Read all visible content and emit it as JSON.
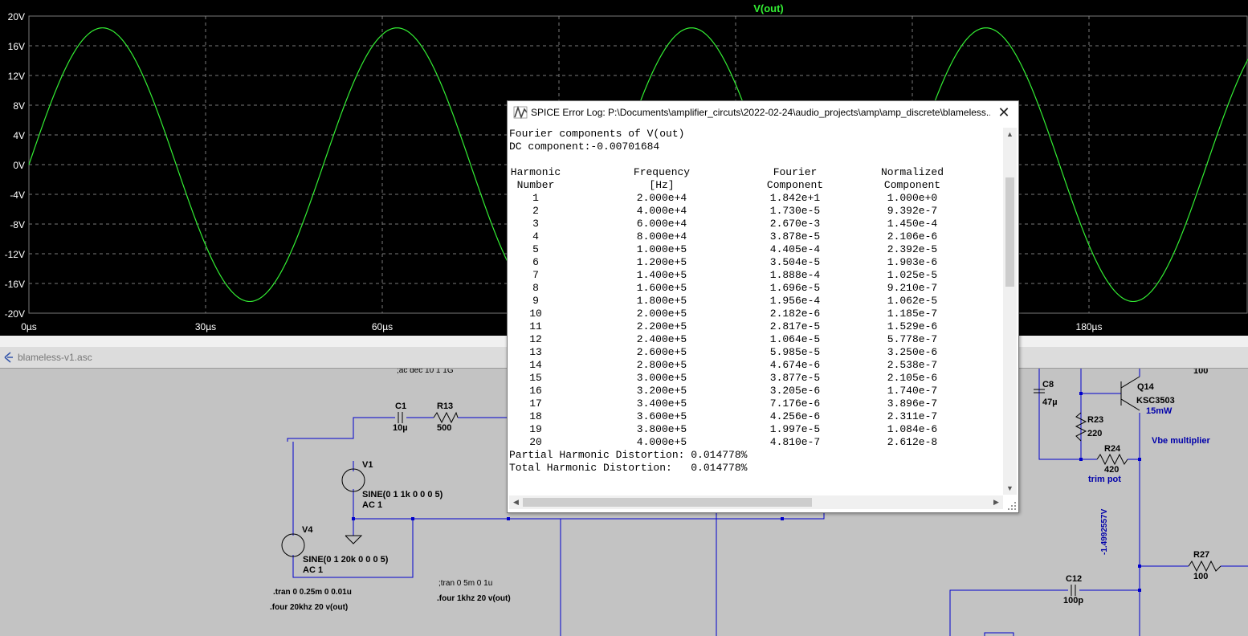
{
  "plot": {
    "trace_name": "V(out)",
    "y_ticks": [
      "20V",
      "16V",
      "12V",
      "8V",
      "4V",
      "0V",
      "-4V",
      "-8V",
      "-12V",
      "-16V",
      "-20V"
    ],
    "x_ticks": [
      "0µs",
      "30µs",
      "60µs",
      "180µs"
    ],
    "colors": {
      "background": "#000000",
      "trace": "#33ee33",
      "grid": "#7a7a7a",
      "axis_text": "#ffffff"
    }
  },
  "chart_data": {
    "type": "line",
    "title": "V(out)",
    "xlabel": "",
    "ylabel": "",
    "xlim": [
      0,
      207
    ],
    "ylim": [
      -20,
      20
    ],
    "grid": true,
    "series": [
      {
        "name": "V(out)",
        "function": "sine",
        "amplitude": 18.42,
        "frequency_hz": 20000,
        "offset": -0.007
      }
    ]
  },
  "schematic": {
    "tab_title": "blameless-v1.asc",
    "labels": {
      "ac_directive": ";ac dec 10 1 1G",
      "c1": "C1",
      "c1_val": "10µ",
      "r13": "R13",
      "r13_val": "500",
      "v1": "V1",
      "v1_val": "SINE(0 1 1k 0 0 0 5)",
      "v1_ac": "AC 1",
      "v4": "V4",
      "v4_val": "SINE(0 1 20k 0 0 0 5)",
      "v4_ac": "AC 1",
      "tran1": ".tran 0 0.25m 0 0.01u",
      "four1": ".four 20khz 20 v(out)",
      "tran2": ";tran 0 5m 0 1u",
      "four2": ".four 1khz 20 v(out)",
      "c8": "C8",
      "c8_val": "47µ",
      "r23": "R23",
      "r23_val": "220",
      "r24": "R24",
      "r24_val": "420",
      "trim": "trim pot",
      "q14": "Q14",
      "q14_val": "KSC3503",
      "q14_power": "15mW",
      "vbe": "Vbe multiplier",
      "r_top_val": "100",
      "voltage": "-1.4992557V",
      "r27": "R27",
      "r27_val": "100",
      "c12": "C12",
      "c12_val": "100p"
    }
  },
  "dialog": {
    "title": "SPICE Error Log: P:\\Documents\\amplifier_circuts\\2022-02-24\\audio_projects\\amp\\amp_discrete\\blameless...",
    "close_glyph": "✕",
    "line1": "Fourier components of V(out)",
    "line2": "DC component:-0.00701684",
    "headers1": [
      "Harmonic",
      "Frequency",
      "Fourier",
      "Normalized"
    ],
    "headers2": [
      "Number",
      "[Hz]",
      "Component",
      "Component"
    ],
    "rows": [
      [
        "1",
        "2.000e+4",
        "1.842e+1",
        "1.000e+0"
      ],
      [
        "2",
        "4.000e+4",
        "1.730e-5",
        "9.392e-7"
      ],
      [
        "3",
        "6.000e+4",
        "2.670e-3",
        "1.450e-4"
      ],
      [
        "4",
        "8.000e+4",
        "3.878e-5",
        "2.106e-6"
      ],
      [
        "5",
        "1.000e+5",
        "4.405e-4",
        "2.392e-5"
      ],
      [
        "6",
        "1.200e+5",
        "3.504e-5",
        "1.903e-6"
      ],
      [
        "7",
        "1.400e+5",
        "1.888e-4",
        "1.025e-5"
      ],
      [
        "8",
        "1.600e+5",
        "1.696e-5",
        "9.210e-7"
      ],
      [
        "9",
        "1.800e+5",
        "1.956e-4",
        "1.062e-5"
      ],
      [
        "10",
        "2.000e+5",
        "2.182e-6",
        "1.185e-7"
      ],
      [
        "11",
        "2.200e+5",
        "2.817e-5",
        "1.529e-6"
      ],
      [
        "12",
        "2.400e+5",
        "1.064e-5",
        "5.778e-7"
      ],
      [
        "13",
        "2.600e+5",
        "5.985e-5",
        "3.250e-6"
      ],
      [
        "14",
        "2.800e+5",
        "4.674e-6",
        "2.538e-7"
      ],
      [
        "15",
        "3.000e+5",
        "3.877e-5",
        "2.105e-6"
      ],
      [
        "16",
        "3.200e+5",
        "3.205e-6",
        "1.740e-7"
      ],
      [
        "17",
        "3.400e+5",
        "7.176e-6",
        "3.896e-7"
      ],
      [
        "18",
        "3.600e+5",
        "4.256e-6",
        "2.311e-7"
      ],
      [
        "19",
        "3.800e+5",
        "1.997e-5",
        "1.084e-6"
      ],
      [
        "20",
        "4.000e+5",
        "4.810e-7",
        "2.612e-8"
      ]
    ],
    "partial_hd": "Partial Harmonic Distortion: 0.014778%",
    "total_hd": "Total Harmonic Distortion:   0.014778%"
  }
}
